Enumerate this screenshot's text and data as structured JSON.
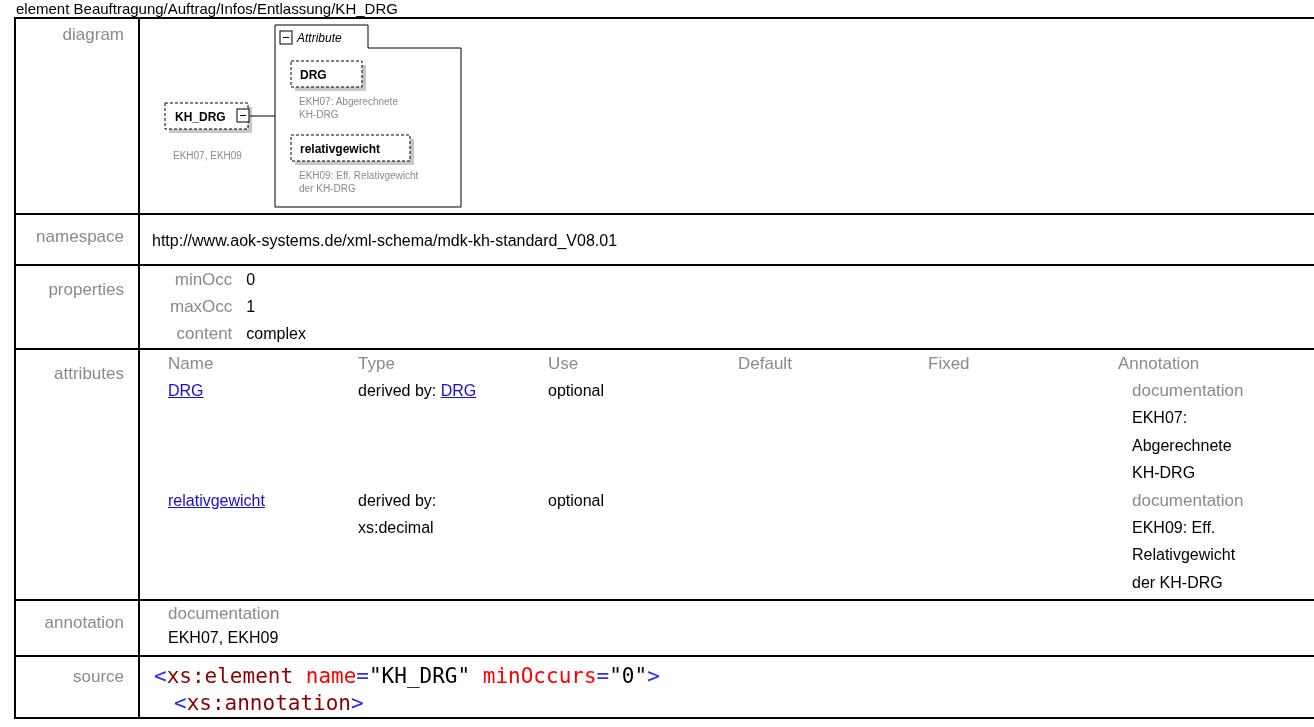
{
  "heading": "element Beauftragung/Auftrag/Infos/Entlassung/KH_DRG",
  "diagram": {
    "label": "diagram",
    "element": {
      "name": "KH_DRG",
      "note": "EKH07, EKH09",
      "expanded": true
    },
    "group": {
      "title": "Attribute",
      "expanded": true,
      "items": [
        {
          "name": "DRG",
          "note_lines": [
            "EKH07: Abgerechnete",
            "KH-DRG"
          ]
        },
        {
          "name": "relativgewicht",
          "note_lines": [
            "EKH09: Eff. Relativgewicht",
            "der KH-DRG"
          ]
        }
      ]
    }
  },
  "namespace": {
    "label": "namespace",
    "value": "http://www.aok-systems.de/xml-schema/mdk-kh-standard_V08.01"
  },
  "properties": {
    "label": "properties",
    "items": [
      {
        "name": "minOcc",
        "value": "0"
      },
      {
        "name": "maxOcc",
        "value": "1"
      },
      {
        "name": "content",
        "value": "complex"
      }
    ]
  },
  "attributes": {
    "label": "attributes",
    "columns": [
      "Name",
      "Type",
      "Use",
      "Default",
      "Fixed",
      "Annotation"
    ],
    "rows": [
      {
        "name": "DRG",
        "type_text": "derived by:",
        "type_link": "DRG",
        "use": "optional",
        "annotation_label": "documentation",
        "annotation": "EKH07: Abgerechnete KH-DRG"
      },
      {
        "name": "relativgewicht",
        "type_text": "derived by: xs:decimal",
        "use": "optional",
        "annotation_label": "documentation",
        "annotation": "EKH09: Eff. Relativgewicht der KH-DRG"
      }
    ]
  },
  "annotation": {
    "label": "annotation",
    "doc_label": "documentation",
    "text": "EKH07, EKH09"
  },
  "source": {
    "label": "source",
    "lines": [
      {
        "tokens": [
          {
            "kind": "punct",
            "text": "<"
          },
          {
            "kind": "tag",
            "text": "xs:element"
          },
          {
            "kind": "attr",
            "text": " name"
          },
          {
            "kind": "punct",
            "text": "="
          },
          {
            "kind": "value",
            "text": "\"KH_DRG\""
          },
          {
            "kind": "attr",
            "text": " minOccurs"
          },
          {
            "kind": "punct",
            "text": "="
          },
          {
            "kind": "value",
            "text": "\"0\""
          },
          {
            "kind": "punct",
            "text": ">"
          }
        ],
        "children": [
          {
            "tokens": [
              {
                "kind": "punct",
                "text": "<"
              },
              {
                "kind": "tag",
                "text": "xs:annotation"
              },
              {
                "kind": "punct",
                "text": ">"
              }
            ]
          }
        ]
      }
    ]
  }
}
